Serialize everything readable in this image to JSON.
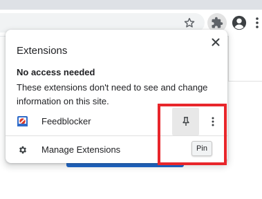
{
  "popup": {
    "title": "Extensions",
    "section_heading": "No access needed",
    "section_desc": "These extensions don't need to see and change information on this site.",
    "extension": {
      "name": "Feedblocker",
      "icon": "feedblocker-icon"
    },
    "manage_label": "Manage Extensions",
    "pin_tooltip": "Pin"
  },
  "toolbar": {
    "icons": [
      "star-icon",
      "puzzle-icon",
      "profile-icon",
      "more-vert-icon"
    ]
  },
  "colors": {
    "highlight": "#e8262b",
    "accent_blue": "#1a63c9"
  }
}
